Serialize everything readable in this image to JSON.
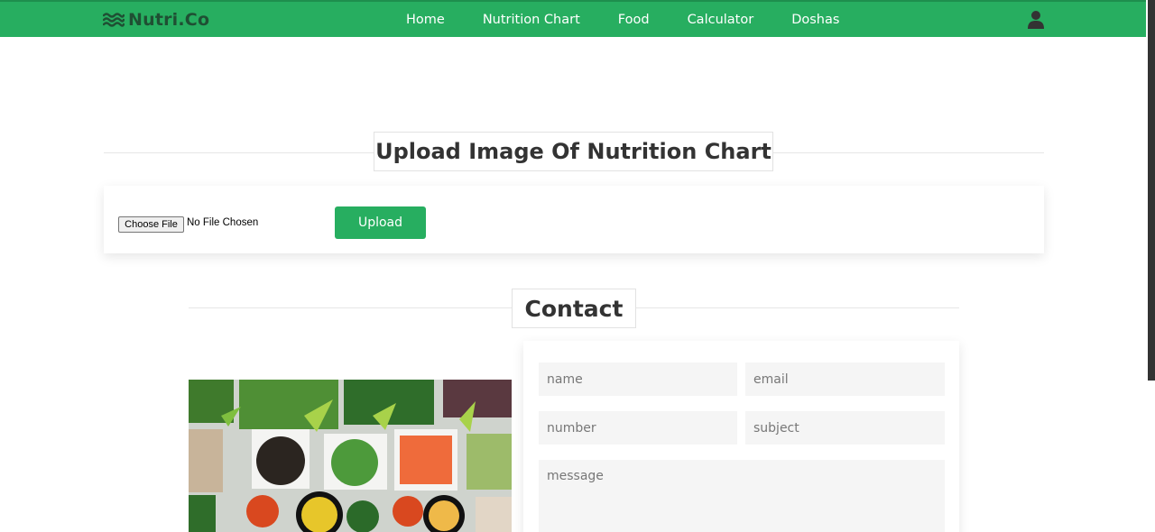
{
  "brand": {
    "name": "Nutri.Co",
    "icon": "waves-icon"
  },
  "nav": {
    "items": [
      "Home",
      "Nutrition Chart",
      "Food",
      "Calculator",
      "Doshas"
    ],
    "user_icon": "user-icon"
  },
  "upload_section": {
    "title": "Upload Image Of Nutrition Chart",
    "choose_file_label": "Choose File",
    "file_status": "No File Chosen",
    "upload_label": "Upload"
  },
  "contact_section": {
    "title": "Contact",
    "form": {
      "name_placeholder": "name",
      "email_placeholder": "email",
      "number_placeholder": "number",
      "subject_placeholder": "subject",
      "message_placeholder": "message"
    }
  },
  "colors": {
    "accent": "#27ae60",
    "brand_text": "#1f4f33",
    "heading_text": "#333333",
    "field_bg": "#f5f5f5"
  }
}
